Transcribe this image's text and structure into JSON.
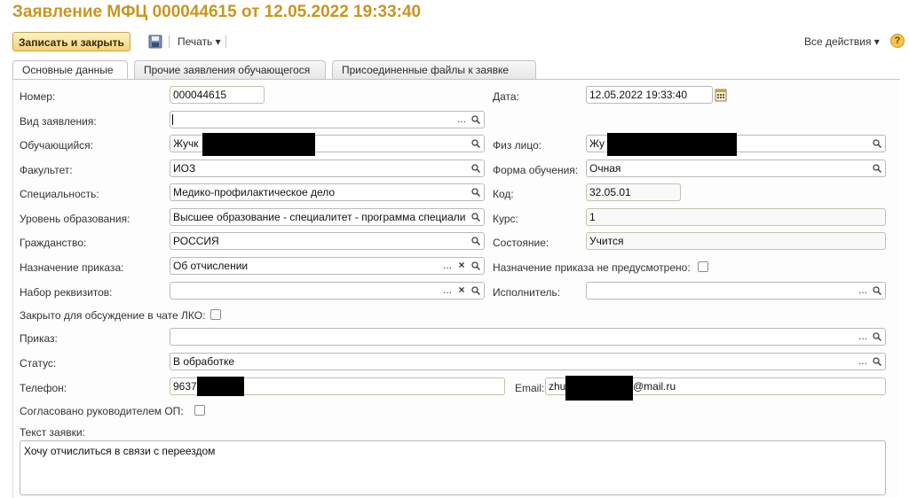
{
  "window": {
    "title": "Заявление МФЦ 000044615 от 12.05.2022 19:33:40"
  },
  "toolbar": {
    "save_close_label": "Записать и закрыть",
    "print_label": "Печать ▾",
    "all_actions_label": "Все действия ▾",
    "help_label": "?"
  },
  "tabs": [
    {
      "label": "Основные данные"
    },
    {
      "label": "Прочие заявления обучающегося"
    },
    {
      "label": "Присоединенные файлы к заявке"
    }
  ],
  "form": {
    "number": {
      "label": "Номер:",
      "value": "000044615"
    },
    "date": {
      "label": "Дата:",
      "value": "12.05.2022 19:33:40"
    },
    "request_type": {
      "label": "Вид заявления:",
      "value": ""
    },
    "student": {
      "label": "Обучающийся:",
      "value": "Жучк"
    },
    "person": {
      "label": "Физ лицо:",
      "value": "Жу"
    },
    "faculty": {
      "label": "Факультет:",
      "value": "ИОЗ"
    },
    "study_form": {
      "label": "Форма обучения:",
      "value": "Очная"
    },
    "specialty": {
      "label": "Специальность:",
      "value": "Медико-профилактическое дело"
    },
    "code": {
      "label": "Код:",
      "value": "32.05.01"
    },
    "edu_level": {
      "label": "Уровень образования:",
      "value": "Высшее образование - специалитет - программа специали"
    },
    "course": {
      "label": "Курс:",
      "value": "1"
    },
    "citizenship": {
      "label": "Гражданство:",
      "value": "РОССИЯ"
    },
    "state": {
      "label": "Состояние:",
      "value": "Учится"
    },
    "order_purpose": {
      "label": "Назначение приказа:",
      "value": "Об отчислении"
    },
    "order_not_provided": {
      "label": "Назначение приказа не предусмотрено:",
      "checked": false
    },
    "requisites_set": {
      "label": "Набор реквизитов:",
      "value": ""
    },
    "executor": {
      "label": "Исполнитель:",
      "value": ""
    },
    "closed_chat": {
      "label": "Закрыто для обсуждение в чате ЛКО:",
      "checked": false
    },
    "order": {
      "label": "Приказ:",
      "value": ""
    },
    "status": {
      "label": "Статус:",
      "value": "В обработке"
    },
    "phone": {
      "label": "Телефон:",
      "value": "9637"
    },
    "email": {
      "label": "Email:",
      "value_prefix": "zhu",
      "value_suffix": "@mail.ru"
    },
    "approved_by_head": {
      "label": "Согласовано руководителем ОП:",
      "checked": false
    },
    "request_text": {
      "label": "Текст заявки:",
      "value": "Хочу отчислиться в связи с переездом"
    }
  },
  "icons": {
    "choice": "...",
    "clear": "×",
    "search": "search-icon",
    "calendar": "calendar-icon",
    "save": "floppy-disk-icon"
  },
  "colors": {
    "title": "#c8961e",
    "accent_button": "#f0d37a",
    "redaction": "#000000"
  }
}
